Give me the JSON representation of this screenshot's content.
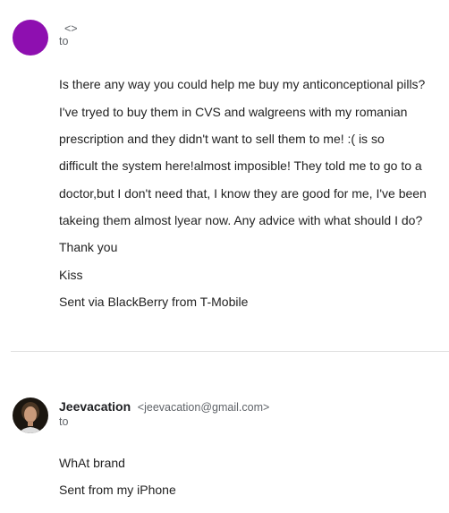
{
  "message1": {
    "sender_email": "<>",
    "to_label": "to",
    "body": [
      "Is there any way you could help me buy my anticonceptional pills?",
      "I've tryed to buy them in CVS and walgreens with my romanian",
      "prescription and they didn't want to sell them to me! :( is so",
      "difficult the system here!almost imposible! They told me to go to a",
      "doctor,but I don't need that, I know they are good for me, I've been",
      "takeing them almost lyear now. Any advice with what should I do?",
      "Thank you",
      "Kiss",
      "Sent via BlackBerry from T-Mobile"
    ],
    "avatar_color": "#8e0fb0"
  },
  "message2": {
    "sender_name": "Jeevacation",
    "sender_email": "<jeevacation@gmail.com>",
    "to_label": "to",
    "body": [
      "WhAt brand",
      "Sent from my iPhone"
    ]
  },
  "colors": {
    "divider": "#e0e0e0",
    "secondary_text": "#5f6368"
  }
}
